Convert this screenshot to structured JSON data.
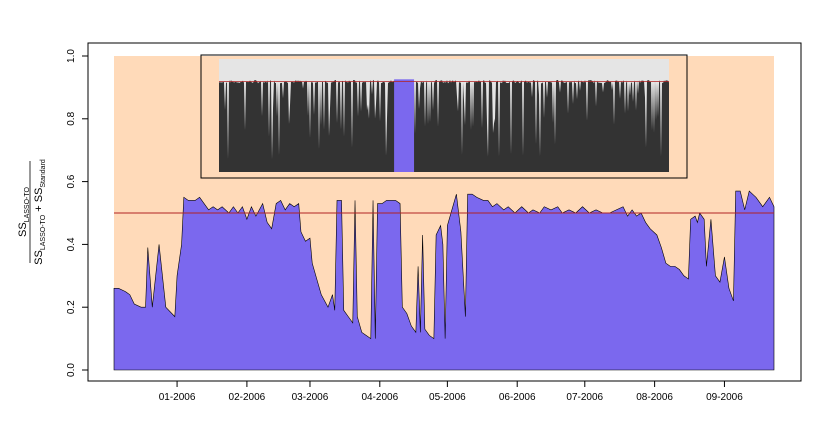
{
  "chart_data": {
    "type": "area",
    "title": "",
    "xlabel": "",
    "ylabel": {
      "numerator": "SS",
      "numerator_sub": "LASSO-TO",
      "denominator_a": "SS",
      "denominator_a_sub": "LASSO-TO",
      "plus": " + ",
      "denominator_b": "SS",
      "denominator_b_sub": "Standard"
    },
    "ylim": [
      0,
      1
    ],
    "yticks": [
      "0.0",
      "0.2",
      "0.4",
      "0.6",
      "0.8",
      "1.0"
    ],
    "xlim": [
      "2005-12-01",
      "2006-10-06"
    ],
    "xticks": [
      {
        "label": "01-2006",
        "date": "2006-01-01"
      },
      {
        "label": "02-2006",
        "date": "2006-02-01"
      },
      {
        "label": "03-2006",
        "date": "2006-03-01"
      },
      {
        "label": "04-2006",
        "date": "2006-04-01"
      },
      {
        "label": "05-2006",
        "date": "2006-05-01"
      },
      {
        "label": "06-2006",
        "date": "2006-06-01"
      },
      {
        "label": "07-2006",
        "date": "2006-07-01"
      },
      {
        "label": "08-2006",
        "date": "2006-08-01"
      },
      {
        "label": "09-2006",
        "date": "2006-09-01"
      }
    ],
    "reference_line": 0.5,
    "grid": false,
    "legend": "none",
    "colors": {
      "area": "#7b68ee",
      "background_band": "#ffdab9",
      "reference_line": "#b22222",
      "inset_fill": "#333333",
      "inset_background": "#e5e5e5"
    },
    "series": [
      {
        "values": [
          [
            "2005-12-04",
            0.26
          ],
          [
            "2005-12-06",
            0.26
          ],
          [
            "2005-12-09",
            0.25
          ],
          [
            "2005-12-11",
            0.24
          ],
          [
            "2005-12-13",
            0.21
          ],
          [
            "2005-12-16",
            0.2
          ],
          [
            "2005-12-18",
            0.2
          ],
          [
            "2005-12-19",
            0.39
          ],
          [
            "2005-12-21",
            0.2
          ],
          [
            "2005-12-24",
            0.4
          ],
          [
            "2005-12-27",
            0.2
          ],
          [
            "2005-12-31",
            0.17
          ],
          [
            "2006-01-01",
            0.3
          ],
          [
            "2006-01-03",
            0.4
          ],
          [
            "2006-01-04",
            0.55
          ],
          [
            "2006-01-06",
            0.54
          ],
          [
            "2006-01-09",
            0.54
          ],
          [
            "2006-01-11",
            0.55
          ],
          [
            "2006-01-13",
            0.53
          ],
          [
            "2006-01-15",
            0.51
          ],
          [
            "2006-01-17",
            0.52
          ],
          [
            "2006-01-19",
            0.51
          ],
          [
            "2006-01-21",
            0.52
          ],
          [
            "2006-01-24",
            0.5
          ],
          [
            "2006-01-26",
            0.52
          ],
          [
            "2006-01-28",
            0.5
          ],
          [
            "2006-01-30",
            0.52
          ],
          [
            "2006-02-01",
            0.48
          ],
          [
            "2006-02-03",
            0.52
          ],
          [
            "2006-02-05",
            0.49
          ],
          [
            "2006-02-08",
            0.53
          ],
          [
            "2006-02-10",
            0.47
          ],
          [
            "2006-02-12",
            0.45
          ],
          [
            "2006-02-14",
            0.53
          ],
          [
            "2006-02-16",
            0.54
          ],
          [
            "2006-02-18",
            0.51
          ],
          [
            "2006-02-20",
            0.53
          ],
          [
            "2006-02-22",
            0.52
          ],
          [
            "2006-02-24",
            0.53
          ],
          [
            "2006-02-25",
            0.44
          ],
          [
            "2006-02-27",
            0.41
          ],
          [
            "2006-03-01",
            0.42
          ],
          [
            "2006-03-02",
            0.34
          ],
          [
            "2006-03-04",
            0.29
          ],
          [
            "2006-03-06",
            0.24
          ],
          [
            "2006-03-09",
            0.2
          ],
          [
            "2006-03-11",
            0.24
          ],
          [
            "2006-03-12",
            0.19
          ],
          [
            "2006-03-13",
            0.54
          ],
          [
            "2006-03-15",
            0.54
          ],
          [
            "2006-03-16",
            0.19
          ],
          [
            "2006-03-18",
            0.17
          ],
          [
            "2006-03-20",
            0.15
          ],
          [
            "2006-03-21",
            0.54
          ],
          [
            "2006-03-22",
            0.17
          ],
          [
            "2006-03-24",
            0.12
          ],
          [
            "2006-03-26",
            0.11
          ],
          [
            "2006-03-28",
            0.1
          ],
          [
            "2006-03-29",
            0.54
          ],
          [
            "2006-03-30",
            0.1
          ],
          [
            "2006-03-31",
            0.53
          ],
          [
            "2006-04-02",
            0.53
          ],
          [
            "2006-04-04",
            0.54
          ],
          [
            "2006-04-08",
            0.54
          ],
          [
            "2006-04-10",
            0.53
          ],
          [
            "2006-04-11",
            0.2
          ],
          [
            "2006-04-13",
            0.18
          ],
          [
            "2006-04-15",
            0.14
          ],
          [
            "2006-04-17",
            0.12
          ],
          [
            "2006-04-18",
            0.33
          ],
          [
            "2006-04-19",
            0.12
          ],
          [
            "2006-04-20",
            0.43
          ],
          [
            "2006-04-21",
            0.13
          ],
          [
            "2006-04-23",
            0.11
          ],
          [
            "2006-04-25",
            0.1
          ],
          [
            "2006-04-26",
            0.43
          ],
          [
            "2006-04-28",
            0.46
          ],
          [
            "2006-04-29",
            0.4
          ],
          [
            "2006-04-30",
            0.1
          ],
          [
            "2006-05-01",
            0.46
          ],
          [
            "2006-05-03",
            0.51
          ],
          [
            "2006-05-05",
            0.56
          ],
          [
            "2006-05-07",
            0.44
          ],
          [
            "2006-05-09",
            0.17
          ],
          [
            "2006-05-10",
            0.56
          ],
          [
            "2006-05-12",
            0.56
          ],
          [
            "2006-05-14",
            0.55
          ],
          [
            "2006-05-17",
            0.54
          ],
          [
            "2006-05-19",
            0.54
          ],
          [
            "2006-05-21",
            0.52
          ],
          [
            "2006-05-23",
            0.53
          ],
          [
            "2006-05-26",
            0.51
          ],
          [
            "2006-05-28",
            0.52
          ],
          [
            "2006-05-31",
            0.5
          ],
          [
            "2006-06-03",
            0.52
          ],
          [
            "2006-06-06",
            0.5
          ],
          [
            "2006-06-08",
            0.51
          ],
          [
            "2006-06-11",
            0.5
          ],
          [
            "2006-06-13",
            0.52
          ],
          [
            "2006-06-16",
            0.51
          ],
          [
            "2006-06-19",
            0.52
          ],
          [
            "2006-06-21",
            0.5
          ],
          [
            "2006-06-24",
            0.51
          ],
          [
            "2006-06-27",
            0.5
          ],
          [
            "2006-06-30",
            0.52
          ],
          [
            "2006-07-03",
            0.5
          ],
          [
            "2006-07-06",
            0.51
          ],
          [
            "2006-07-09",
            0.5
          ],
          [
            "2006-07-12",
            0.5
          ],
          [
            "2006-07-15",
            0.51
          ],
          [
            "2006-07-18",
            0.52
          ],
          [
            "2006-07-20",
            0.49
          ],
          [
            "2006-07-22",
            0.51
          ],
          [
            "2006-07-24",
            0.49
          ],
          [
            "2006-07-26",
            0.5
          ],
          [
            "2006-07-28",
            0.47
          ],
          [
            "2006-07-30",
            0.45
          ],
          [
            "2006-08-02",
            0.43
          ],
          [
            "2006-08-04",
            0.39
          ],
          [
            "2006-08-06",
            0.34
          ],
          [
            "2006-08-08",
            0.33
          ],
          [
            "2006-08-10",
            0.33
          ],
          [
            "2006-08-12",
            0.32
          ],
          [
            "2006-08-14",
            0.3
          ],
          [
            "2006-08-16",
            0.29
          ],
          [
            "2006-08-17",
            0.48
          ],
          [
            "2006-08-19",
            0.49
          ],
          [
            "2006-08-20",
            0.47
          ],
          [
            "2006-08-21",
            0.5
          ],
          [
            "2006-08-23",
            0.48
          ],
          [
            "2006-08-24",
            0.33
          ],
          [
            "2006-08-26",
            0.48
          ],
          [
            "2006-08-28",
            0.3
          ],
          [
            "2006-08-30",
            0.28
          ],
          [
            "2006-09-01",
            0.36
          ],
          [
            "2006-09-03",
            0.26
          ],
          [
            "2006-09-05",
            0.22
          ],
          [
            "2006-09-06",
            0.57
          ],
          [
            "2006-09-08",
            0.57
          ],
          [
            "2006-09-10",
            0.51
          ],
          [
            "2006-09-12",
            0.57
          ],
          [
            "2006-09-15",
            0.55
          ],
          [
            "2006-09-18",
            0.52
          ],
          [
            "2006-09-21",
            0.55
          ],
          [
            "2006-09-23",
            0.52
          ]
        ]
      }
    ],
    "inset": {
      "description_hidden": true,
      "reference_line": 0.8,
      "base_level": 0.8,
      "highlight_range": [
        "2006-03-28",
        "2006-04-10"
      ]
    }
  }
}
